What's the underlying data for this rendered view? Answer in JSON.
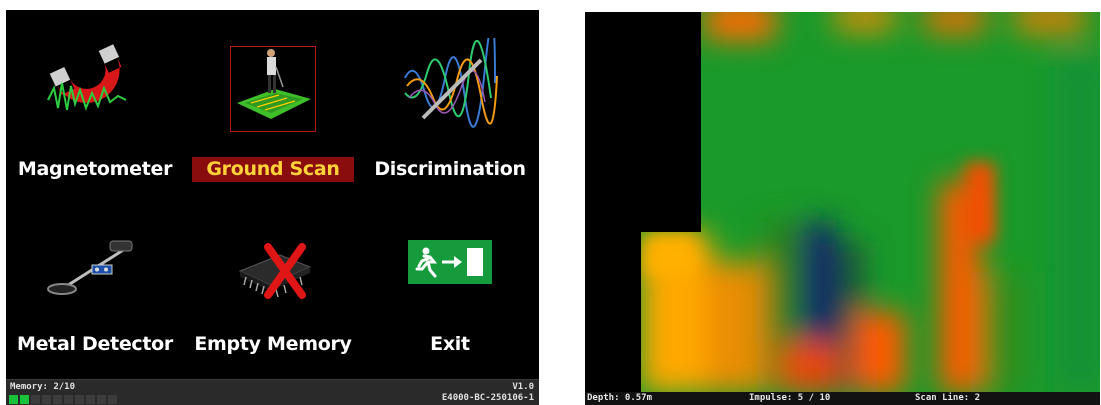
{
  "menu": {
    "items": [
      {
        "label": "Magnetometer",
        "icon": "magnet-icon"
      },
      {
        "label": "Ground Scan",
        "icon": "ground-scan-icon",
        "selected": true
      },
      {
        "label": "Discrimination",
        "icon": "discrimination-waves-icon"
      },
      {
        "label": "Metal Detector",
        "icon": "metal-detector-icon"
      },
      {
        "label": "Empty Memory",
        "icon": "empty-memory-chip-icon"
      },
      {
        "label": "Exit",
        "icon": "exit-sign-icon"
      }
    ]
  },
  "status": {
    "memory": "Memory: 2/10",
    "memory_used": 2,
    "memory_total": 10,
    "version": "V1.0",
    "build": "E4000-BC-250106-1"
  },
  "scan": {
    "depth": "Depth: 0.57m",
    "impulse": "Impulse: 5 / 10",
    "scan_line": "Scan Line: 2"
  },
  "colors": {
    "selected_bg": "#8a0d0d",
    "selected_text": "#ffd23a",
    "memory_on": "#18c23a",
    "scan_green": "#1a9a2a",
    "scan_orange": "#ff6a00",
    "scan_yellow": "#ffa800",
    "scan_blue": "#0a1a6a"
  }
}
